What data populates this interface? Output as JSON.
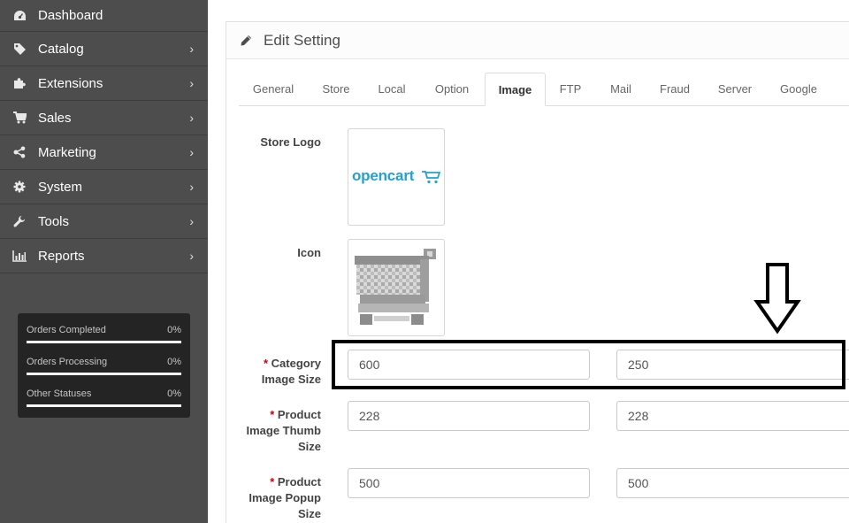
{
  "sidebar": {
    "items": [
      {
        "label": "Dashboard",
        "icon": "dashboard-icon",
        "has_chevron": false
      },
      {
        "label": "Catalog",
        "icon": "tag-icon",
        "has_chevron": true
      },
      {
        "label": "Extensions",
        "icon": "puzzle-icon",
        "has_chevron": true
      },
      {
        "label": "Sales",
        "icon": "cart-icon",
        "has_chevron": true
      },
      {
        "label": "Marketing",
        "icon": "share-icon",
        "has_chevron": true
      },
      {
        "label": "System",
        "icon": "gear-icon",
        "has_chevron": true
      },
      {
        "label": "Tools",
        "icon": "wrench-icon",
        "has_chevron": true
      },
      {
        "label": "Reports",
        "icon": "bar-chart-icon",
        "has_chevron": true
      }
    ],
    "chevron": "›",
    "stats": [
      {
        "label": "Orders Completed",
        "value": "0%",
        "fraction": 0
      },
      {
        "label": "Orders Processing",
        "value": "0%",
        "fraction": 0
      },
      {
        "label": "Other Statuses",
        "value": "0%",
        "fraction": 0
      }
    ]
  },
  "panel": {
    "title": "Edit Setting",
    "title_icon": "pencil-icon",
    "tabs": [
      "General",
      "Store",
      "Local",
      "Option",
      "Image",
      "FTP",
      "Mail",
      "Fraud",
      "Server",
      "Google"
    ],
    "active_tab": "Image"
  },
  "form": {
    "store_logo_label": "Store Logo",
    "store_logo_text": "opencart",
    "icon_label": "Icon",
    "required_mark": "*",
    "category": {
      "label_line1": "Category",
      "label_line2": "Image Size",
      "width": "600",
      "height": "250"
    },
    "product_thumb": {
      "label_line1": "Product",
      "label_line2": "Image Thumb",
      "label_line3": "Size",
      "width": "228",
      "height": "228"
    },
    "product_popup": {
      "label_line1": "Product",
      "label_line2": "Image Popup",
      "label_line3": "Size",
      "width": "500",
      "height": "500"
    }
  },
  "colors": {
    "sidebar_bg": "#4d4d4d",
    "stats_bg": "#242424",
    "logo_blue": "#23a1d1",
    "required": "#cc0000",
    "annotation": "#000000"
  }
}
